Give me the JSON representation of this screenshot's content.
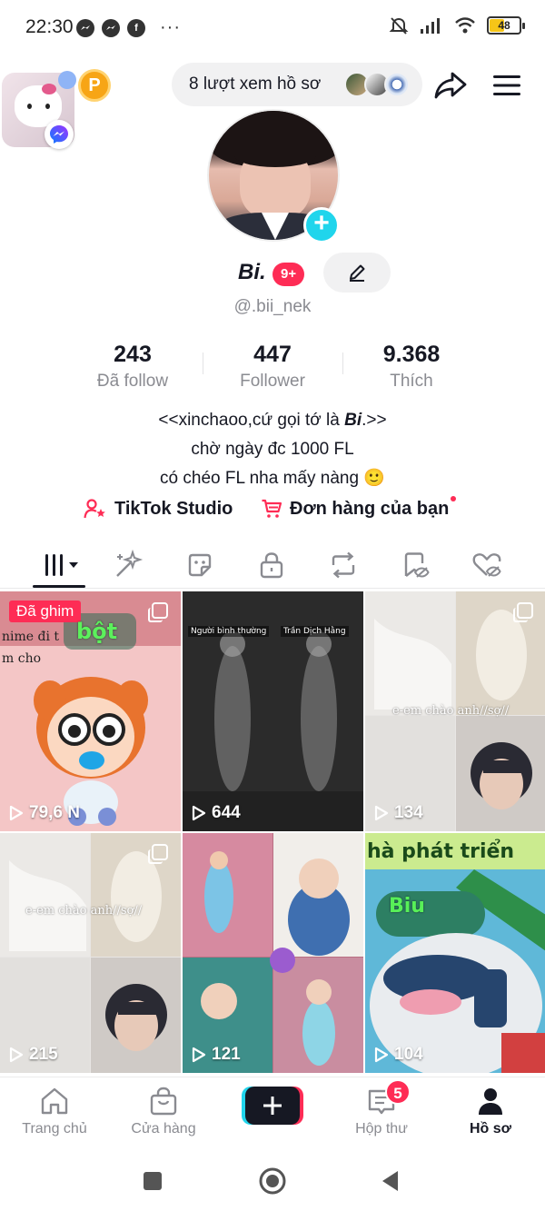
{
  "status_bar": {
    "time": "22:30",
    "battery": "48",
    "battery_level": 0.48,
    "app_icons": [
      "messenger-icon",
      "messenger-icon",
      "facebook-icon"
    ],
    "more": "···"
  },
  "header": {
    "coin_label": "P",
    "profile_views": "8 lượt xem hồ sơ"
  },
  "profile": {
    "display_name": "Bi.",
    "notification_badge": "9+",
    "username": "@.bii_nek",
    "stats": [
      {
        "value": "243",
        "label": "Đã follow"
      },
      {
        "value": "447",
        "label": "Follower"
      },
      {
        "value": "9.368",
        "label": "Thích"
      }
    ],
    "bio": {
      "line1_prefix": "<<xinchaoo,cứ gọi tớ là ",
      "line1_bold": "Bi",
      "line1_suffix": ".>>",
      "line2": "chờ ngày đc 1000 FL",
      "line3": "có chéo FL nha mấy nàng 🙂"
    },
    "links": {
      "studio": "TikTok Studio",
      "orders": "Đơn hàng của bạn"
    }
  },
  "videos": [
    {
      "views": "79,6 N",
      "pinned_label": "Đã ghim",
      "overlay": [
        "nime đi t",
        "m cho"
      ],
      "sticker_text": "bột"
    },
    {
      "views": "644",
      "overlay": [
        "Người bình thường",
        "Trần Dịch Hằng"
      ]
    },
    {
      "views": "134",
      "overlay": [
        "e-em chào anh//sợ//"
      ]
    },
    {
      "views": "215",
      "overlay": [
        "e-em chào anh//sợ//"
      ]
    },
    {
      "views": "121",
      "overlay": []
    },
    {
      "views": "104",
      "overlay": [
        "hà phát triển",
        "Biu"
      ]
    }
  ],
  "bottom_nav": {
    "home": "Trang chủ",
    "shop": "Cửa hàng",
    "inbox": "Hộp thư",
    "inbox_badge": "5",
    "profile": "Hồ sơ"
  },
  "colors": {
    "brand_red": "#fe2c55",
    "brand_cyan": "#20d5ec",
    "text_primary": "#161823",
    "text_secondary": "#8a8b91"
  }
}
